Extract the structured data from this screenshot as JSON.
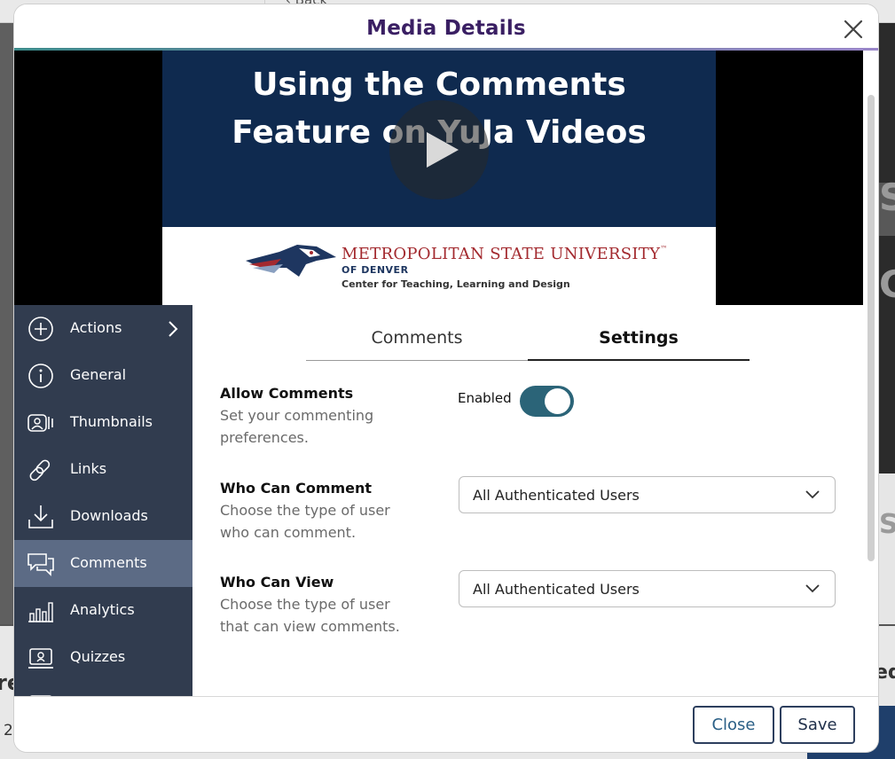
{
  "background": {
    "back_label": "‹ Back",
    "left_fragment": "re",
    "left_number": "2",
    "right_fragment": "ed",
    "right_glyph_top": "S",
    "right_glyph_mid": "C",
    "right_glyph_low": "S"
  },
  "modal": {
    "title": "Media Details",
    "close_icon": "close-icon"
  },
  "video": {
    "slide_title_line1": "Using the Comments",
    "slide_title_line2": "Feature on YuJa Videos",
    "logo_name": "METROPOLITAN STATE UNIVERSITY",
    "logo_tm": "™",
    "logo_sub": "OF DENVER",
    "logo_center": "Center for Teaching, Learning and Design",
    "play_icon": "play-icon"
  },
  "sidebar": {
    "items": [
      {
        "label": "Actions",
        "icon": "plus-circle-icon",
        "has_chevron": true
      },
      {
        "label": "General",
        "icon": "info-icon"
      },
      {
        "label": "Thumbnails",
        "icon": "thumbnails-icon"
      },
      {
        "label": "Links",
        "icon": "link-icon"
      },
      {
        "label": "Downloads",
        "icon": "download-icon"
      },
      {
        "label": "Comments",
        "icon": "comments-icon",
        "active": true
      },
      {
        "label": "Analytics",
        "icon": "analytics-icon"
      },
      {
        "label": "Quizzes",
        "icon": "quizzes-icon"
      }
    ]
  },
  "tabs": {
    "comments": "Comments",
    "settings": "Settings",
    "active": "Settings"
  },
  "settings": {
    "allow_comments": {
      "title": "Allow Comments",
      "desc": "Set your commenting preferences.",
      "toggle_label": "Enabled",
      "enabled": true
    },
    "who_can_comment": {
      "title": "Who Can Comment",
      "desc": "Choose the type of user who can comment.",
      "value": "All Authenticated Users"
    },
    "who_can_view": {
      "title": "Who Can View",
      "desc": "Choose the type of user that can view comments.",
      "value": "All Authenticated Users"
    }
  },
  "footer": {
    "close_label": "Close",
    "save_label": "Save"
  },
  "colors": {
    "title": "#3a1f63",
    "sidebar": "#313c4f",
    "sidebar_active": "#5c6b85",
    "toggle_on": "#2b6478",
    "button_border": "#2d3f5e"
  }
}
